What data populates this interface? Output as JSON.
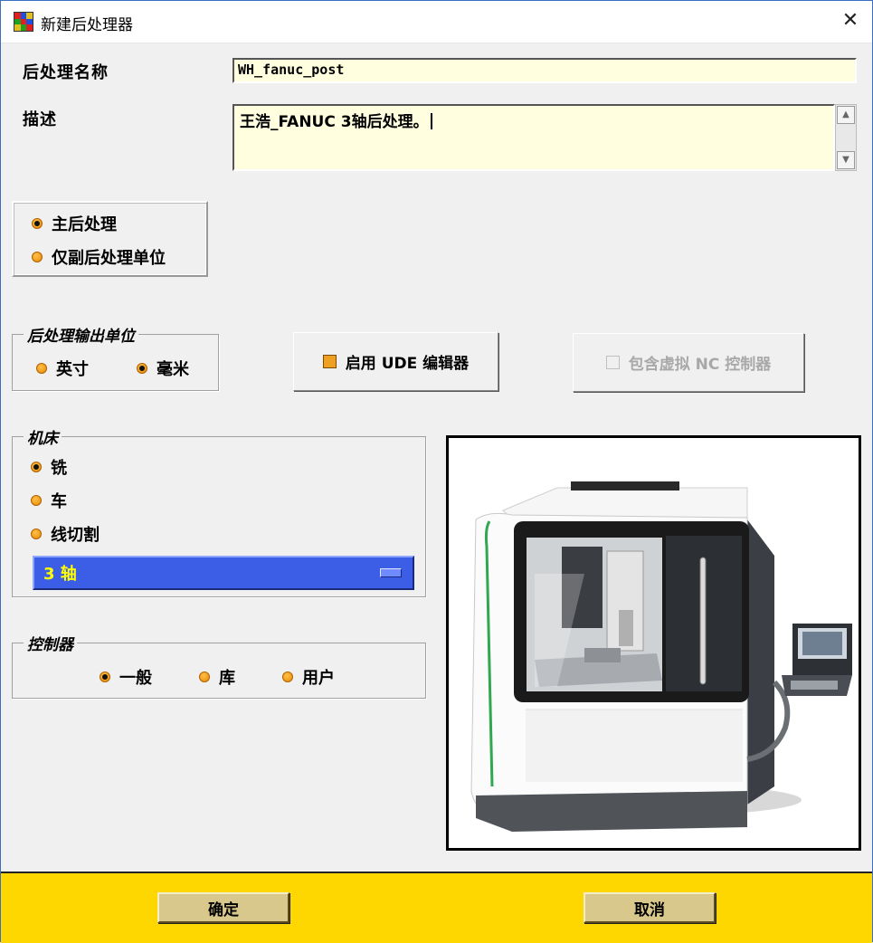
{
  "window": {
    "title": "新建后处理器",
    "close_glyph": "✕"
  },
  "form": {
    "name_label": "后处理名称",
    "name_value": "WH_fanuc_post",
    "desc_label": "描述",
    "desc_value": "王浩_FANUC 3轴后处理。"
  },
  "post_type": {
    "options": [
      "主后处理",
      "仅副后处理单位"
    ],
    "selected": 0
  },
  "output_units": {
    "title": "后处理输出单位",
    "options": [
      "英寸",
      "毫米"
    ],
    "selected": 1
  },
  "ude_button": {
    "label": "启用 UDE 编辑器",
    "checked": true
  },
  "virtual_nc_button": {
    "label": "包含虚拟 NC 控制器",
    "checked": false,
    "enabled": false
  },
  "machine": {
    "title": "机床",
    "options": [
      "铣",
      "车",
      "线切割"
    ],
    "selected": 0,
    "axis_value": "3 轴"
  },
  "controller": {
    "title": "控制器",
    "options": [
      "一般",
      "库",
      "用户"
    ],
    "selected": 0
  },
  "footer": {
    "ok_label": "确定",
    "cancel_label": "取消"
  },
  "colors": {
    "footer_bg": "#ffd700",
    "field_bg": "#ffffe0",
    "combo_bg": "#3c5de6",
    "combo_text": "#ffff00",
    "radio_dot": "#f0a020"
  },
  "icons": {
    "app": "app-grid-icon",
    "close": "close-icon",
    "machine_picture": "machine-tool-image"
  }
}
